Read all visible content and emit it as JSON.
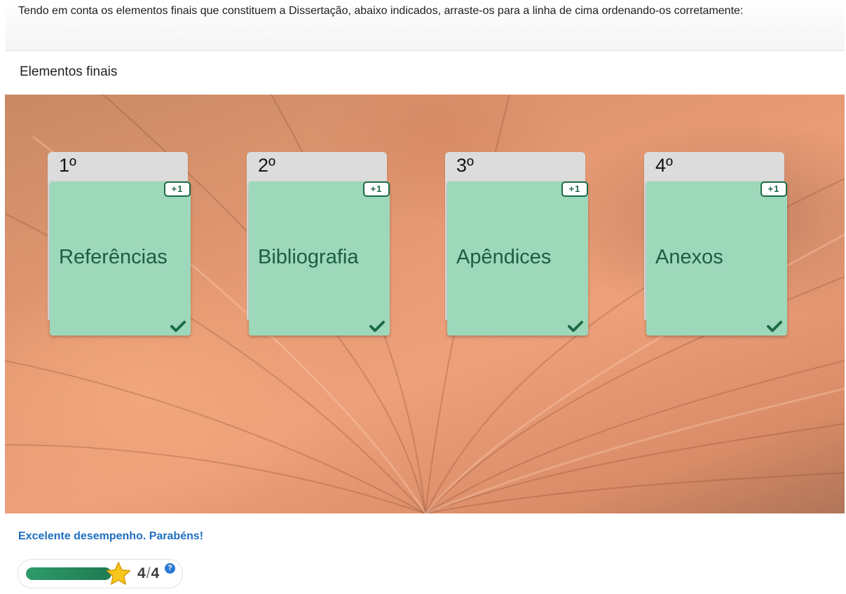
{
  "question": {
    "text": "Tendo em conta os elementos finais que constituem a Dissertação, abaixo indicados, arraste-os para a linha de cima ordenando-os corretamente:"
  },
  "task": {
    "title": "Elementos finais"
  },
  "slots": [
    {
      "label": "1º",
      "card": {
        "text": "Referências",
        "badge": "+1",
        "correct": true
      }
    },
    {
      "label": "2º",
      "card": {
        "text": "Bibliografia",
        "badge": "+1",
        "correct": true
      }
    },
    {
      "label": "3º",
      "card": {
        "text": "Apêndices",
        "badge": "+1",
        "correct": true
      }
    },
    {
      "label": "4º",
      "card": {
        "text": "Anexos",
        "badge": "+1",
        "correct": true
      }
    }
  ],
  "feedback": {
    "text": "Excelente desempenho. Parabéns!"
  },
  "score": {
    "value": "4",
    "separator": "/",
    "max": "4",
    "progress_fraction": 1.0,
    "help_label": "?"
  },
  "colors": {
    "card_bg": "#9ed8bb",
    "card_text": "#1b5e40",
    "feedback": "#1f6fc0",
    "progress": "#2e9b6a"
  },
  "icons": {
    "check": "check-icon",
    "star": "star-icon",
    "help": "help-icon"
  }
}
